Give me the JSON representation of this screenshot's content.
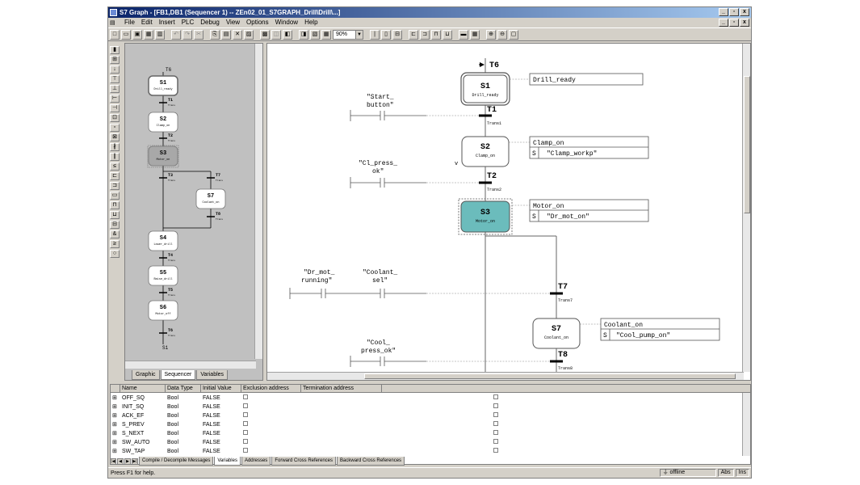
{
  "window": {
    "title": "S7 Graph - [FB1,DB1 (Sequencer 1) -- ZEn02_01_S7GRAPH_Drill\\Drill\\...]",
    "min": "_",
    "restore": "▫",
    "close": "x"
  },
  "menu": {
    "items": [
      "File",
      "Edit",
      "Insert",
      "PLC",
      "Debug",
      "View",
      "Options",
      "Window",
      "Help"
    ]
  },
  "toolbar": {
    "zoom": "90%"
  },
  "overview": {
    "tabs": [
      "Graphic",
      "Sequencer",
      "Variables"
    ],
    "top_label": "T6",
    "end_label": "S1",
    "steps": [
      {
        "id": "S1",
        "name": "Drill_ready"
      },
      {
        "id": "S2",
        "name": "Clamp_on"
      },
      {
        "id": "S3",
        "name": "Motor_on"
      },
      {
        "id": "S7",
        "name": "Coolant_on"
      },
      {
        "id": "S4",
        "name": "Lower_drill"
      },
      {
        "id": "S5",
        "name": "Raise_drill"
      },
      {
        "id": "S6",
        "name": "Motor_off"
      }
    ],
    "transitions": [
      "T1",
      "T2",
      "T3",
      "T7",
      "T8",
      "T4",
      "T5",
      "T6"
    ],
    "trans_name": "Trans"
  },
  "graph": {
    "top_transition": "T6",
    "steps": [
      {
        "id": "S1",
        "name": "Drill_ready",
        "action_header": "Drill_ready",
        "qualifier": "",
        "operand": ""
      },
      {
        "id": "S2",
        "name": "Clamp_on",
        "action_header": "Clamp_on",
        "qualifier": "S",
        "operand": "\"Clamp_workp\""
      },
      {
        "id": "S3",
        "name": "Motor_on",
        "action_header": "Motor_on",
        "qualifier": "S",
        "operand": "\"Dr_mot_on\""
      },
      {
        "id": "S7",
        "name": "Coolant_on",
        "action_header": "Coolant_on",
        "qualifier": "S",
        "operand": "\"Cool_pump_on\""
      }
    ],
    "transitions": [
      {
        "id": "T1",
        "name": "Trans1"
      },
      {
        "id": "T2",
        "name": "Trans2"
      },
      {
        "id": "T7",
        "name": "Trans7"
      },
      {
        "id": "T8",
        "name": "Trans8"
      }
    ],
    "contacts": {
      "start_1": "\"Start_",
      "start_2": "button\"",
      "cl_1": "\"Cl_press_",
      "cl_2": "ok\"",
      "drmot_1": "\"Dr_mot_",
      "drmot_2": "running\"",
      "coolsel_1": "\"Coolant_",
      "coolsel_2": "sel\"",
      "coolp_1": "\"Cool_",
      "coolp_2": "press_ok\""
    },
    "colors": {
      "active_step": "#6bbcbc"
    }
  },
  "variables": {
    "headers": [
      "Name",
      "Data Type",
      "Initial Value",
      "Exclusion address",
      "Termination address"
    ],
    "rows": [
      {
        "name": "OFF_SQ",
        "type": "Bool",
        "init": "FALSE"
      },
      {
        "name": "INIT_SQ",
        "type": "Bool",
        "init": "FALSE"
      },
      {
        "name": "ACK_EF",
        "type": "Bool",
        "init": "FALSE"
      },
      {
        "name": "S_PREV",
        "type": "Bool",
        "init": "FALSE"
      },
      {
        "name": "S_NEXT",
        "type": "Bool",
        "init": "FALSE"
      },
      {
        "name": "SW_AUTO",
        "type": "Bool",
        "init": "FALSE"
      },
      {
        "name": "SW_TAP",
        "type": "Bool",
        "init": "FALSE"
      }
    ],
    "tabs": [
      "Compile / Decompile Messages",
      "Variables",
      "Addresses",
      "Forward Cross References",
      "Backward Cross References"
    ]
  },
  "status": {
    "message": "Press F1 for help.",
    "mode": "offline",
    "abs": "Abs",
    "ins": "Ins"
  }
}
